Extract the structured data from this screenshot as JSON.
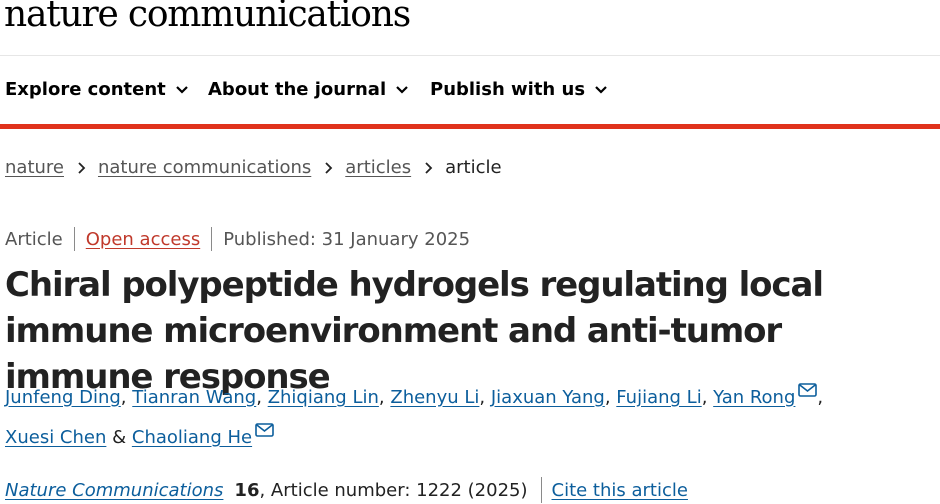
{
  "site": {
    "logo_text": "nature communications"
  },
  "nav": {
    "items": [
      {
        "label": "Explore content"
      },
      {
        "label": "About the journal"
      },
      {
        "label": "Publish with us"
      }
    ]
  },
  "colors": {
    "accent_bar": "#e0321c",
    "link": "#0c5e9c",
    "open_access": "#c0392b"
  },
  "breadcrumb": {
    "items": [
      {
        "label": "nature"
      },
      {
        "label": "nature communications"
      },
      {
        "label": "articles"
      }
    ],
    "current": "article"
  },
  "article": {
    "type": "Article",
    "access": "Open access",
    "published": "Published: 31 January 2025",
    "title": "Chiral polypeptide hydrogels regulating local immune microenvironment and anti-tumor immune response",
    "authors": [
      {
        "name": "Junfeng Ding",
        "separator": ",",
        "has_email": false
      },
      {
        "name": "Tianran Wang",
        "separator": ",",
        "has_email": false
      },
      {
        "name": "Zhiqiang Lin",
        "separator": ",",
        "has_email": false
      },
      {
        "name": "Zhenyu Li",
        "separator": ",",
        "has_email": false
      },
      {
        "name": "Jiaxuan Yang",
        "separator": ",",
        "has_email": false
      },
      {
        "name": "Fujiang Li",
        "separator": ",",
        "has_email": false
      },
      {
        "name": "Yan Rong",
        "separator": ",",
        "has_email": true
      },
      {
        "name": "Xuesi Chen",
        "separator": " &",
        "has_email": false
      },
      {
        "name": "Chaoliang He",
        "separator": "",
        "has_email": true
      }
    ],
    "journal": "Nature Communications",
    "volume": "16",
    "article_number": ", Article number: 1222 (2025)",
    "cite_label": "Cite this article"
  },
  "icons": {
    "nav_dropdown": "chevron-down-icon",
    "breadcrumb_separator": "chevron-right-icon",
    "author_email": "envelope-icon"
  }
}
